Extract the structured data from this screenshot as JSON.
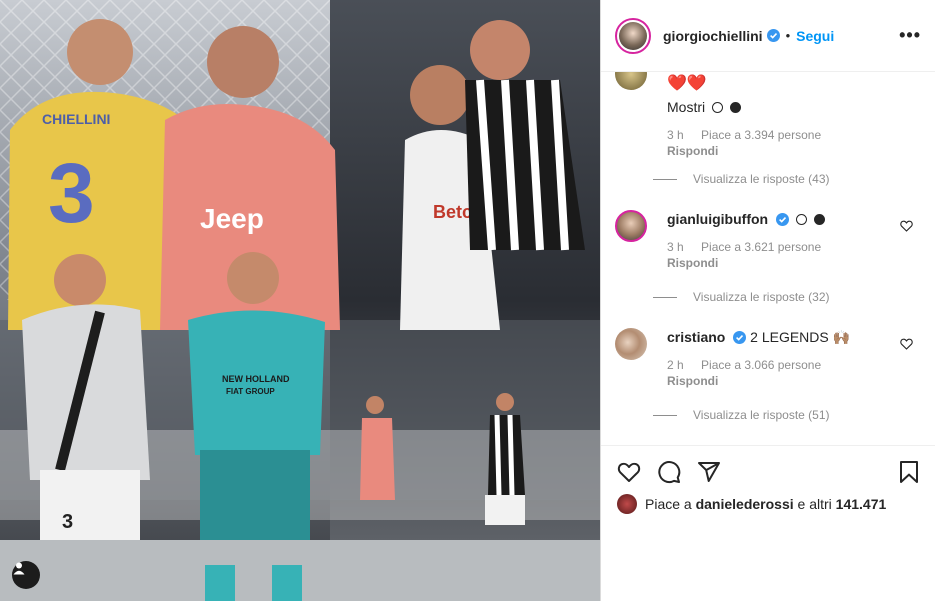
{
  "post": {
    "author": "giorgiochiellini",
    "separator": "•",
    "follow_label": "Segui",
    "more_label": "•••",
    "image_alt": "Collage Chiellini e Buffon",
    "photo_texts": {
      "jersey_name": "CHIELLINI",
      "jersey_number": "3",
      "sponsor": "Jeep",
      "sponsor2": "Betclic",
      "sponsor3": "NEW HOLLAND",
      "sponsor3b": "FIAT GROUP"
    }
  },
  "comments": [
    {
      "user": "",
      "text_prefix": "❤️❤️",
      "text": "Mostri",
      "time": "3 h",
      "likes": "Piace a 3.394 persone",
      "reply": "Rispondi",
      "view_replies": "Visualizza le risposte (43)"
    },
    {
      "user": "gianluigibuffon",
      "text": "",
      "time": "3 h",
      "likes": "Piace a 3.621 persone",
      "reply": "Rispondi",
      "view_replies": "Visualizza le risposte (32)"
    },
    {
      "user": "cristiano",
      "text": "2 LEGENDS 🙌🏽",
      "time": "2 h",
      "likes": "Piace a 3.066 persone",
      "reply": "Rispondi",
      "view_replies": "Visualizza le risposte (51)"
    }
  ],
  "likes_bar": {
    "prefix": "Piace a",
    "liker": "danielederossi",
    "suffix": "e altri",
    "count": "141.471"
  },
  "icons": {
    "like": "heart-icon",
    "comment": "comment-icon",
    "share": "share-icon",
    "save": "bookmark-icon",
    "tag": "user-tag-icon",
    "verified": "verified-badge-icon"
  },
  "colors": {
    "accent": "#0095f6",
    "heart": "#ed4956",
    "muted": "#8e8e8e",
    "text": "#262626"
  }
}
